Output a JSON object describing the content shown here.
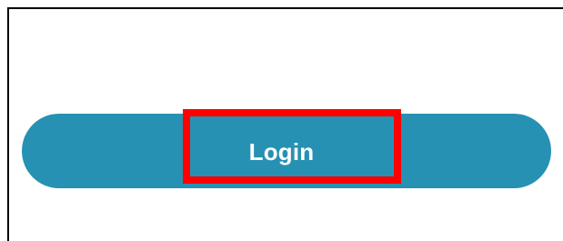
{
  "login_button": {
    "label": "Login"
  },
  "colors": {
    "button_background": "#2791b3",
    "button_text": "#ffffff",
    "highlight_border": "#ff0000",
    "frame_border": "#000000"
  }
}
